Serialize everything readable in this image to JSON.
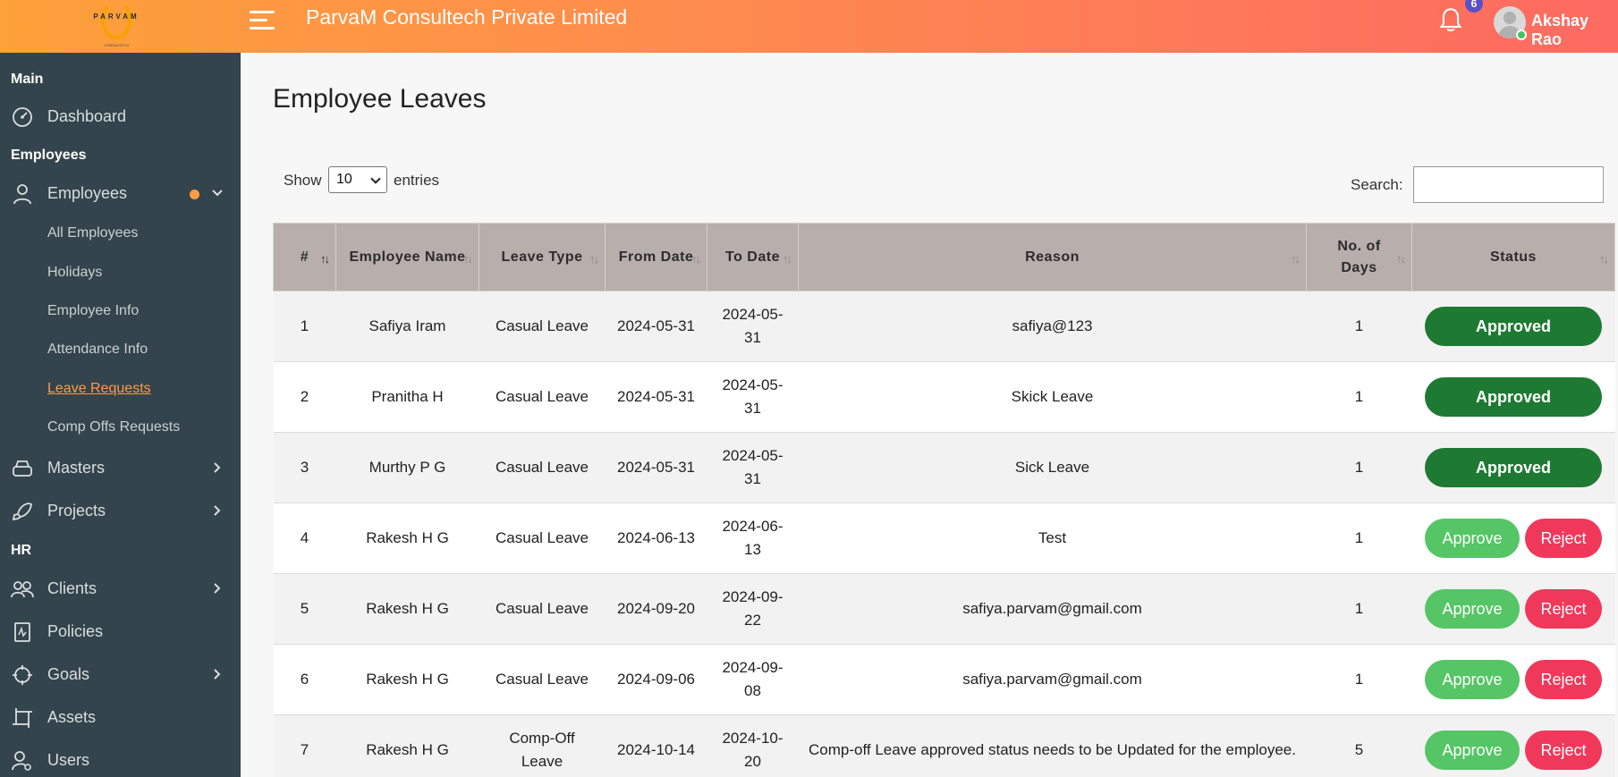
{
  "header": {
    "logo_text": "PARVAM",
    "logo_sub": "CONSULTECH",
    "company": "ParvaM Consultech Private Limited",
    "notification_count": "6",
    "user_name": "Akshay Rao"
  },
  "sidebar": {
    "sections": [
      "Main",
      "Employees",
      "HR"
    ],
    "dashboard": "Dashboard",
    "employees": "Employees",
    "sub_items": [
      "All Employees",
      "Holidays",
      "Employee Info",
      "Attendance Info",
      "Leave Requests",
      "Comp Offs Requests"
    ],
    "masters": "Masters",
    "projects": "Projects",
    "clients": "Clients",
    "policies": "Policies",
    "goals": "Goals",
    "assets": "Assets",
    "users": "Users"
  },
  "main": {
    "title": "Employee Leaves",
    "show_label": "Show",
    "page_size": "10",
    "entries_label": "entries",
    "search_label": "Search:",
    "search_value": ""
  },
  "table": {
    "columns": [
      "#",
      "Employee Name",
      "Leave Type",
      "From Date",
      "To Date",
      "Reason",
      "No. of Days",
      "Status"
    ],
    "rows": [
      {
        "no": "1",
        "name": "Safiya Iram",
        "type": "Casual Leave",
        "from": "2024-05-31",
        "to": "2024-05-31",
        "reason": "safiya@123",
        "days": "1",
        "status": "approved"
      },
      {
        "no": "2",
        "name": "Pranitha H",
        "type": "Casual Leave",
        "from": "2024-05-31",
        "to": "2024-05-31",
        "reason": "Skick Leave",
        "days": "1",
        "status": "approved"
      },
      {
        "no": "3",
        "name": "Murthy P G",
        "type": "Casual Leave",
        "from": "2024-05-31",
        "to": "2024-05-31",
        "reason": "Sick Leave",
        "days": "1",
        "status": "approved"
      },
      {
        "no": "4",
        "name": "Rakesh H G",
        "type": "Casual Leave",
        "from": "2024-06-13",
        "to": "2024-06-13",
        "reason": "Test",
        "days": "1",
        "status": "pending"
      },
      {
        "no": "5",
        "name": "Rakesh H G",
        "type": "Casual Leave",
        "from": "2024-09-20",
        "to": "2024-09-22",
        "reason": "safiya.parvam@gmail.com",
        "days": "1",
        "status": "pending"
      },
      {
        "no": "6",
        "name": "Rakesh H G",
        "type": "Casual Leave",
        "from": "2024-09-06",
        "to": "2024-09-08",
        "reason": "safiya.parvam@gmail.com",
        "days": "1",
        "status": "pending"
      },
      {
        "no": "7",
        "name": "Rakesh H G",
        "type": "Comp-Off Leave",
        "from": "2024-10-14",
        "to": "2024-10-20",
        "reason": "Comp-off Leave approved status needs to be Updated for the employee.",
        "days": "5",
        "status": "pending"
      }
    ],
    "labels": {
      "approved": "Approved",
      "approve": "Approve",
      "reject": "Reject"
    }
  },
  "colors": {
    "header_start": "#fda13a",
    "header_end": "#fd6a62",
    "sidebar_bg": "#34444c",
    "accent": "#ff9b44",
    "approved": "#1e7a32",
    "approve": "#55c565",
    "reject": "#f0385a",
    "table_header": "#b8aeab"
  }
}
